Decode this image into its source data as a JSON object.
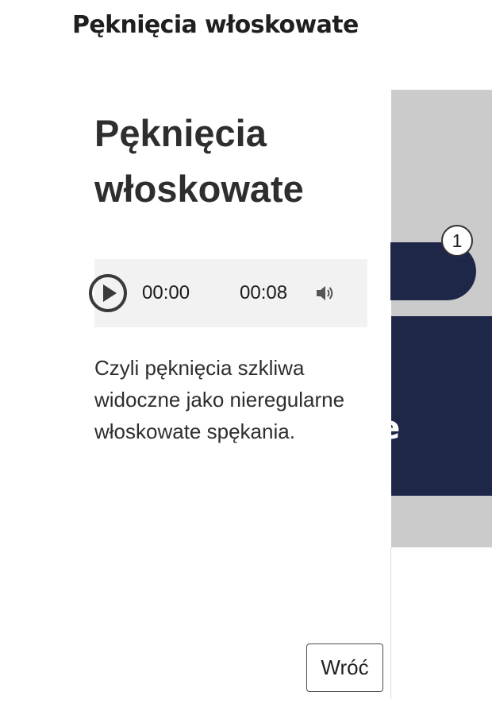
{
  "header": {
    "title": "Pęknięcia włoskowate"
  },
  "background": {
    "badge_number": "1",
    "block_text": "te",
    "colors": {
      "navy": "#1f2749",
      "gray": "#cbcbcb"
    }
  },
  "panel": {
    "title": "Pęknięcia włoskowate",
    "audio": {
      "current_time": "00:00",
      "duration": "00:08",
      "play_icon": "play-icon",
      "volume_icon": "volume-icon"
    },
    "description": "Czyli pęknięcia szkliwa widoczne jako nieregularne włoskowate spękania.",
    "back_label": "Wróć"
  }
}
